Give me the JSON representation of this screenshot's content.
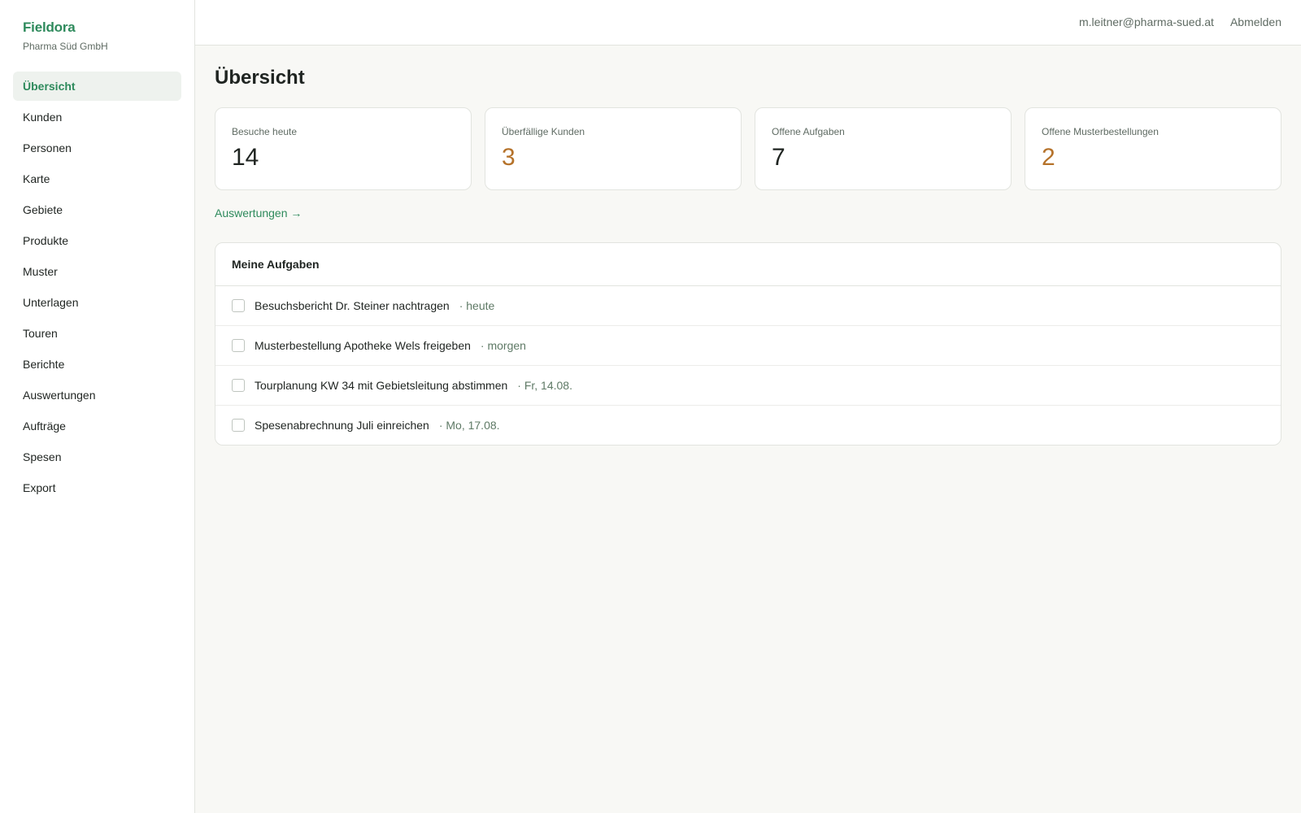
{
  "brand": {
    "name": "Fieldora",
    "org": "Pharma Süd GmbH"
  },
  "nav": {
    "items": [
      {
        "label": "Übersicht",
        "active": true
      },
      {
        "label": "Kunden"
      },
      {
        "label": "Personen"
      },
      {
        "label": "Karte"
      },
      {
        "label": "Gebiete"
      },
      {
        "label": "Produkte"
      },
      {
        "label": "Muster"
      },
      {
        "label": "Unterlagen"
      },
      {
        "label": "Touren"
      },
      {
        "label": "Berichte"
      },
      {
        "label": "Auswertungen"
      },
      {
        "label": "Aufträge"
      },
      {
        "label": "Spesen"
      },
      {
        "label": "Export"
      }
    ]
  },
  "topbar": {
    "user_email": "m.leitner@pharma-sued.at",
    "logout_label": "Abmelden"
  },
  "page": {
    "title": "Übersicht"
  },
  "kpis": [
    {
      "label": "Besuche heute",
      "value": "14",
      "color": "#1f2421"
    },
    {
      "label": "Überfällige Kunden",
      "value": "3",
      "color": "#b5722a"
    },
    {
      "label": "Offene Aufgaben",
      "value": "7",
      "color": "#1f2421"
    },
    {
      "label": "Offene Musterbestellungen",
      "value": "2",
      "color": "#b5722a"
    }
  ],
  "report_link": "Auswertungen →",
  "tasks": {
    "title": "Meine Aufgaben",
    "items": [
      {
        "text": "Besuchsbericht Dr. Steiner nachtragen",
        "due": "· heute",
        "done": false
      },
      {
        "text": "Musterbestellung Apotheke Wels freigeben",
        "due": "· morgen",
        "done": false
      },
      {
        "text": "Tourplanung KW 34 mit Gebietsleitung abstimmen",
        "due": "· Fr, 14.08.",
        "done": false
      },
      {
        "text": "Spesenabrechnung Juli einreichen",
        "due": "· Mo, 17.08.",
        "done": false
      }
    ]
  },
  "colors": {
    "accent": "#2e8a5c",
    "warning": "#b5722a"
  }
}
